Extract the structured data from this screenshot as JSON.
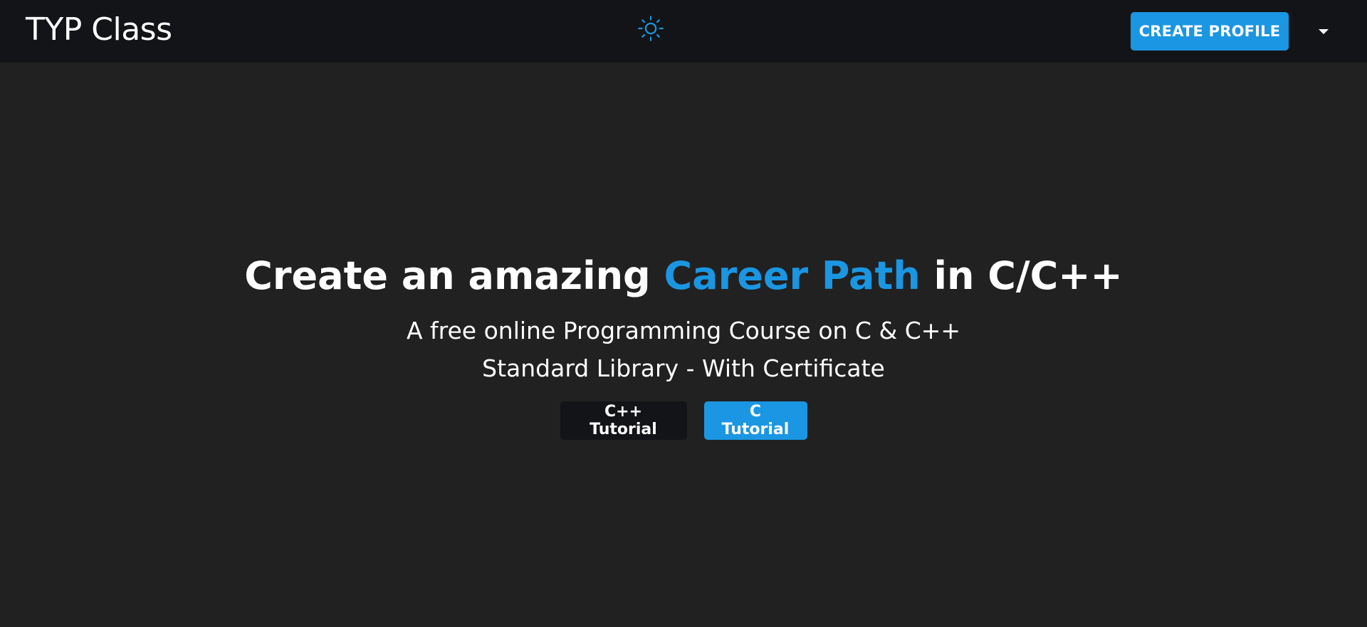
{
  "navbar": {
    "brand": "TYP Class",
    "theme_toggle_icon": "sun-icon",
    "create_profile_label": "CREATE PROFILE",
    "dropdown_icon": "caret-down-icon"
  },
  "hero": {
    "title_part1": "Create an amazing ",
    "title_accent": "Career Path",
    "title_part2": " in C/C++",
    "subtitle_line1": "A free online Programming Course on C & C++",
    "subtitle_line2": "Standard Library - With Certificate",
    "button_cpp": "C++ Tutorial",
    "button_c": "C Tutorial"
  },
  "colors": {
    "page_background": "#212121",
    "navbar_background": "#131417",
    "accent": "#1a96e2",
    "text": "#ffffff"
  }
}
